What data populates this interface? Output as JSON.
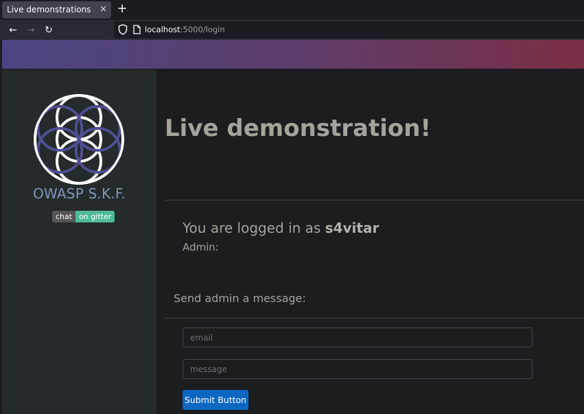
{
  "browser": {
    "tab_title": "Live demonstrations",
    "tab_close": "×",
    "new_tab": "+",
    "url_host": "localhost",
    "url_path": ":5000/login",
    "back_icon": "←",
    "forward_icon": "→",
    "reload_icon": "↻"
  },
  "sidebar": {
    "brand": "OWASP S.K.F.",
    "chat_left": "chat",
    "chat_right": "on gitter"
  },
  "main": {
    "headline": "Live demonstration!",
    "logged_prefix": "You are logged in as ",
    "username": "s4vitar",
    "admin_label": "Admin:",
    "send_label": "Send admin a message:",
    "email_placeholder": "email",
    "message_placeholder": "message",
    "submit_label": "Submit Button"
  },
  "colors": {
    "accent": "#0b67c2",
    "brand": "#7f96b9",
    "badge_green": "#4fb999"
  }
}
